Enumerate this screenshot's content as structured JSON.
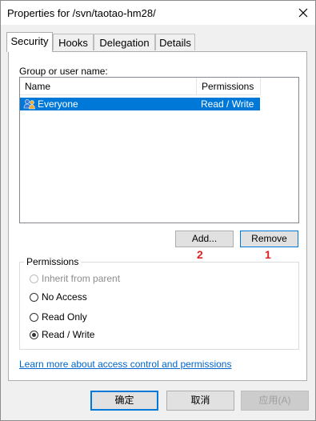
{
  "window": {
    "title": "Properties for /svn/taotao-hm28/",
    "close_icon": "close-icon"
  },
  "tabs": [
    {
      "label": "Security",
      "active": true
    },
    {
      "label": "Hooks",
      "active": false
    },
    {
      "label": "Delegation",
      "active": false
    },
    {
      "label": "Details",
      "active": false
    }
  ],
  "security": {
    "group_label": "Group or user name:",
    "columns": [
      "Name",
      "Permissions"
    ],
    "rows": [
      {
        "name": "Everyone",
        "permissions": "Read / Write",
        "icon": "users-group-icon",
        "selected": true
      }
    ],
    "add_label": "Add...",
    "remove_label": "Remove",
    "annotation_add": "2",
    "annotation_remove": "1",
    "permissions_group_label": "Permissions",
    "options": [
      {
        "label": "Inherit from parent",
        "checked": false,
        "disabled": true
      },
      {
        "label": "No Access",
        "checked": false,
        "disabled": false
      },
      {
        "label": "Read Only",
        "checked": false,
        "disabled": false
      },
      {
        "label": "Read / Write",
        "checked": true,
        "disabled": false
      }
    ],
    "learn_more": "Learn more about access control and permissions"
  },
  "footer": {
    "ok_label": "确定",
    "cancel_label": "取消",
    "apply_label": "应用(A)"
  },
  "colors": {
    "selection": "#0078d7",
    "link": "#0066cc",
    "annotation": "#e02020"
  }
}
